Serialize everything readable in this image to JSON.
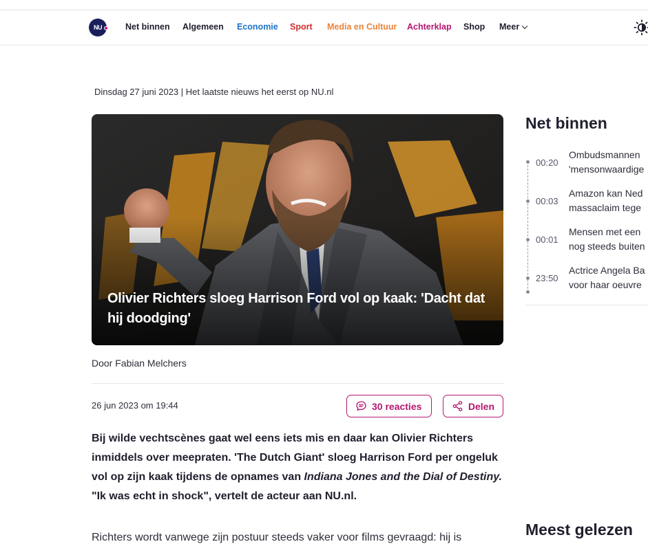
{
  "nav": {
    "logo_text": "NU",
    "items": [
      {
        "label": "Net binnen",
        "color": "#1f1f2e"
      },
      {
        "label": "Algemeen",
        "color": "#1f1f2e"
      },
      {
        "label": "Economie",
        "color": "#1e73c8"
      },
      {
        "label": "Sport",
        "color": "#d12d2d"
      },
      {
        "label": "Media en Cultuur",
        "color": "#e8833a"
      },
      {
        "label": "Achterklap",
        "color": "#b3166f"
      },
      {
        "label": "Shop",
        "color": "#1f1f2e"
      },
      {
        "label": "Meer",
        "color": "#1f1f2e"
      }
    ]
  },
  "dateline": "Dinsdag 27 juni 2023 | Het laatste nieuws het eerst op NU.nl",
  "article": {
    "title": "Olivier Richters sloeg Harrison Ford vol op kaak: 'Dacht dat hij doodging'",
    "author": "Door Fabian Melchers",
    "published": "26 jun 2023 om 19:44",
    "reactions_label": "30 reacties",
    "share_label": "Delen",
    "intro_part1": "Bij wilde vechtscènes gaat wel eens iets mis en daar kan Olivier Richters inmiddels over meepraten. 'The Dutch Giant' sloeg Harrison Ford per ongeluk vol op zijn kaak tijdens de opnames van ",
    "intro_film": "Indiana Jones and the Dial of Destiny.",
    "intro_part2": " \"Ik was echt in shock\", vertelt de acteur aan NU.nl.",
    "body_start": "Richters wordt vanwege zijn postuur steeds vaker voor films gevraagd: hij is"
  },
  "sidebar": {
    "net_binnen_title": "Net binnen",
    "items": [
      {
        "time": "00:20",
        "line1": "Ombudsmannen",
        "line2": "'mensonwaardige"
      },
      {
        "time": "00:03",
        "line1": "Amazon kan Ned",
        "line2": "massaclaim tege"
      },
      {
        "time": "00:01",
        "line1": "Mensen met een",
        "line2": "nog steeds buiten"
      },
      {
        "time": "23:50",
        "line1": "Actrice Angela Ba",
        "line2": "voor haar oeuvre"
      }
    ],
    "meest_gelezen_title": "Meest gelezen"
  }
}
